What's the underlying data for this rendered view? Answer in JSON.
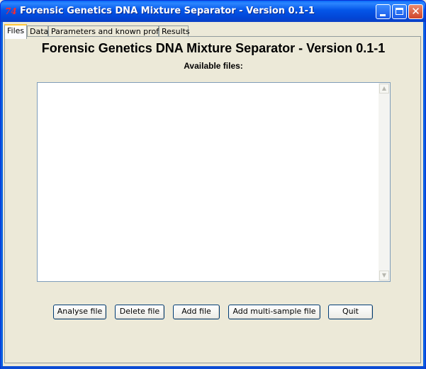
{
  "window": {
    "title": "Forensic Genetics DNA Mixture Separator - Version 0.1-1",
    "icon_text": "74"
  },
  "tabs": [
    {
      "label": "Files",
      "active": true
    },
    {
      "label": "Data",
      "active": false
    },
    {
      "label": "Parameters and known profiles",
      "active": false
    },
    {
      "label": "Results",
      "active": false
    }
  ],
  "files_panel": {
    "heading": "Forensic Genetics DNA Mixture Separator - Version 0.1-1",
    "subheading": "Available files:",
    "files": []
  },
  "buttons": {
    "analyse": "Analyse file",
    "delete": "Delete file",
    "add": "Add file",
    "add_multi": "Add multi-sample file",
    "quit": "Quit"
  },
  "colors": {
    "titlebar": "#0455e8",
    "window_bg": "#ece9d8",
    "active_tab_accent": "#ffc83c"
  }
}
